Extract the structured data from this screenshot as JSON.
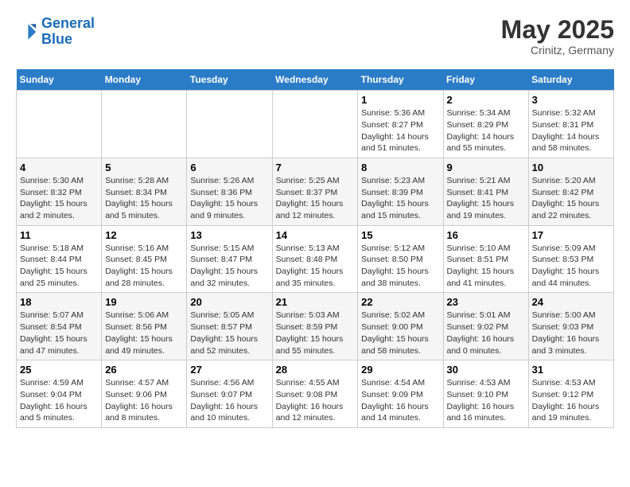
{
  "header": {
    "logo_line1": "General",
    "logo_line2": "Blue",
    "month": "May 2025",
    "location": "Crinitz, Germany"
  },
  "days_of_week": [
    "Sunday",
    "Monday",
    "Tuesday",
    "Wednesday",
    "Thursday",
    "Friday",
    "Saturday"
  ],
  "weeks": [
    [
      {
        "num": "",
        "info": ""
      },
      {
        "num": "",
        "info": ""
      },
      {
        "num": "",
        "info": ""
      },
      {
        "num": "",
        "info": ""
      },
      {
        "num": "1",
        "info": "Sunrise: 5:36 AM\nSunset: 8:27 PM\nDaylight: 14 hours\nand 51 minutes."
      },
      {
        "num": "2",
        "info": "Sunrise: 5:34 AM\nSunset: 8:29 PM\nDaylight: 14 hours\nand 55 minutes."
      },
      {
        "num": "3",
        "info": "Sunrise: 5:32 AM\nSunset: 8:31 PM\nDaylight: 14 hours\nand 58 minutes."
      }
    ],
    [
      {
        "num": "4",
        "info": "Sunrise: 5:30 AM\nSunset: 8:32 PM\nDaylight: 15 hours\nand 2 minutes."
      },
      {
        "num": "5",
        "info": "Sunrise: 5:28 AM\nSunset: 8:34 PM\nDaylight: 15 hours\nand 5 minutes."
      },
      {
        "num": "6",
        "info": "Sunrise: 5:26 AM\nSunset: 8:36 PM\nDaylight: 15 hours\nand 9 minutes."
      },
      {
        "num": "7",
        "info": "Sunrise: 5:25 AM\nSunset: 8:37 PM\nDaylight: 15 hours\nand 12 minutes."
      },
      {
        "num": "8",
        "info": "Sunrise: 5:23 AM\nSunset: 8:39 PM\nDaylight: 15 hours\nand 15 minutes."
      },
      {
        "num": "9",
        "info": "Sunrise: 5:21 AM\nSunset: 8:41 PM\nDaylight: 15 hours\nand 19 minutes."
      },
      {
        "num": "10",
        "info": "Sunrise: 5:20 AM\nSunset: 8:42 PM\nDaylight: 15 hours\nand 22 minutes."
      }
    ],
    [
      {
        "num": "11",
        "info": "Sunrise: 5:18 AM\nSunset: 8:44 PM\nDaylight: 15 hours\nand 25 minutes."
      },
      {
        "num": "12",
        "info": "Sunrise: 5:16 AM\nSunset: 8:45 PM\nDaylight: 15 hours\nand 28 minutes."
      },
      {
        "num": "13",
        "info": "Sunrise: 5:15 AM\nSunset: 8:47 PM\nDaylight: 15 hours\nand 32 minutes."
      },
      {
        "num": "14",
        "info": "Sunrise: 5:13 AM\nSunset: 8:48 PM\nDaylight: 15 hours\nand 35 minutes."
      },
      {
        "num": "15",
        "info": "Sunrise: 5:12 AM\nSunset: 8:50 PM\nDaylight: 15 hours\nand 38 minutes."
      },
      {
        "num": "16",
        "info": "Sunrise: 5:10 AM\nSunset: 8:51 PM\nDaylight: 15 hours\nand 41 minutes."
      },
      {
        "num": "17",
        "info": "Sunrise: 5:09 AM\nSunset: 8:53 PM\nDaylight: 15 hours\nand 44 minutes."
      }
    ],
    [
      {
        "num": "18",
        "info": "Sunrise: 5:07 AM\nSunset: 8:54 PM\nDaylight: 15 hours\nand 47 minutes."
      },
      {
        "num": "19",
        "info": "Sunrise: 5:06 AM\nSunset: 8:56 PM\nDaylight: 15 hours\nand 49 minutes."
      },
      {
        "num": "20",
        "info": "Sunrise: 5:05 AM\nSunset: 8:57 PM\nDaylight: 15 hours\nand 52 minutes."
      },
      {
        "num": "21",
        "info": "Sunrise: 5:03 AM\nSunset: 8:59 PM\nDaylight: 15 hours\nand 55 minutes."
      },
      {
        "num": "22",
        "info": "Sunrise: 5:02 AM\nSunset: 9:00 PM\nDaylight: 15 hours\nand 58 minutes."
      },
      {
        "num": "23",
        "info": "Sunrise: 5:01 AM\nSunset: 9:02 PM\nDaylight: 16 hours\nand 0 minutes."
      },
      {
        "num": "24",
        "info": "Sunrise: 5:00 AM\nSunset: 9:03 PM\nDaylight: 16 hours\nand 3 minutes."
      }
    ],
    [
      {
        "num": "25",
        "info": "Sunrise: 4:59 AM\nSunset: 9:04 PM\nDaylight: 16 hours\nand 5 minutes."
      },
      {
        "num": "26",
        "info": "Sunrise: 4:57 AM\nSunset: 9:06 PM\nDaylight: 16 hours\nand 8 minutes."
      },
      {
        "num": "27",
        "info": "Sunrise: 4:56 AM\nSunset: 9:07 PM\nDaylight: 16 hours\nand 10 minutes."
      },
      {
        "num": "28",
        "info": "Sunrise: 4:55 AM\nSunset: 9:08 PM\nDaylight: 16 hours\nand 12 minutes."
      },
      {
        "num": "29",
        "info": "Sunrise: 4:54 AM\nSunset: 9:09 PM\nDaylight: 16 hours\nand 14 minutes."
      },
      {
        "num": "30",
        "info": "Sunrise: 4:53 AM\nSunset: 9:10 PM\nDaylight: 16 hours\nand 16 minutes."
      },
      {
        "num": "31",
        "info": "Sunrise: 4:53 AM\nSunset: 9:12 PM\nDaylight: 16 hours\nand 19 minutes."
      }
    ]
  ]
}
